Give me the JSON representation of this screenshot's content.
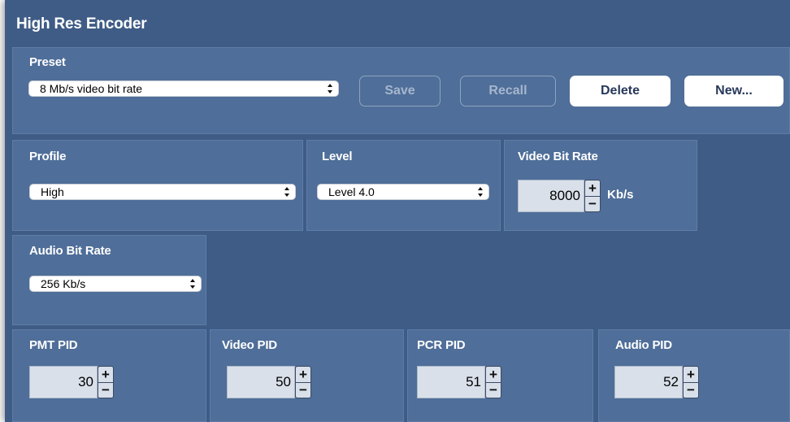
{
  "window": {
    "title": "High Res Encoder"
  },
  "preset": {
    "label": "Preset",
    "selected": "8 Mb/s video bit rate",
    "buttons": {
      "save": "Save",
      "recall": "Recall",
      "delete": "Delete",
      "new": "New..."
    }
  },
  "profile": {
    "label": "Profile",
    "selected": "High"
  },
  "level": {
    "label": "Level",
    "selected": "Level 4.0"
  },
  "video_bit_rate": {
    "label": "Video Bit Rate",
    "value": "8000",
    "unit": "Kb/s"
  },
  "audio_bit_rate": {
    "label": "Audio Bit Rate",
    "selected": "256 Kb/s"
  },
  "pids": [
    {
      "label": "PMT PID",
      "value": "30"
    },
    {
      "label": "Video PID",
      "value": "50"
    },
    {
      "label": "PCR PID",
      "value": "51"
    },
    {
      "label": "Audio PID",
      "value": "52"
    }
  ],
  "stepper_symbols": {
    "plus": "+",
    "minus": "−"
  }
}
